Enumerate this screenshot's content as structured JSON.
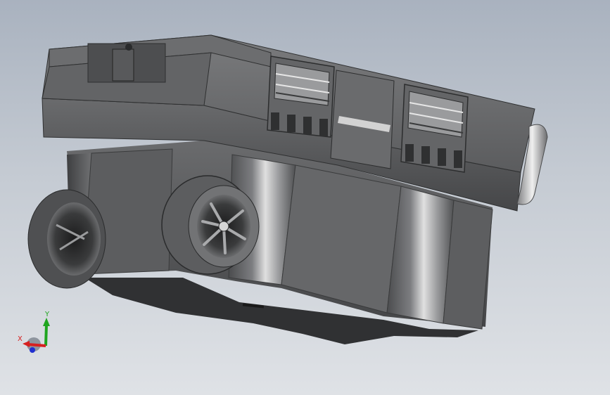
{
  "viewport": {
    "background_top": "#a9b2bf",
    "background_bottom": "#dfe2e6"
  },
  "model": {
    "part_color": "#5f6062",
    "highlight_color": "#d9d9d9",
    "shadow_color": "#2f3031"
  },
  "triad": {
    "x_label": "X",
    "y_label": "Y",
    "x_color": "#d62020",
    "y_color": "#1fa51f",
    "z_color": "#2030d0"
  }
}
